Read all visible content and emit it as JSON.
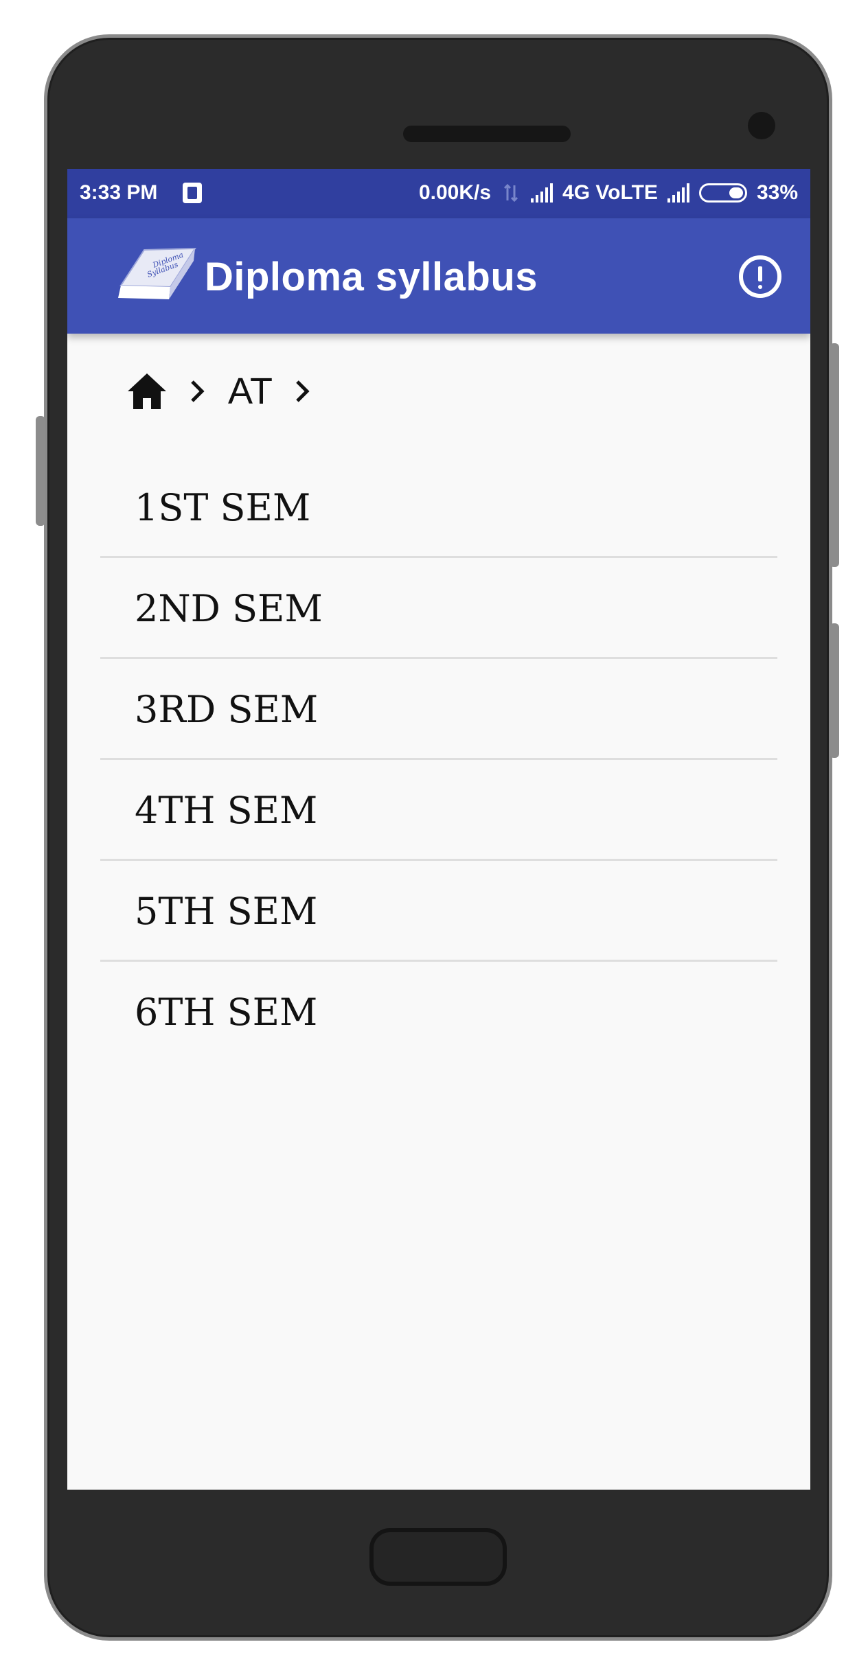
{
  "status_bar": {
    "time": "3:33 PM",
    "network_speed": "0.00K/s",
    "network_type": "4G VoLTE",
    "battery_percent": "33%"
  },
  "app_bar": {
    "title": "Diploma syllabus",
    "logo_text_line1": "Diploma",
    "logo_text_line2": "Syllabus"
  },
  "breadcrumb": {
    "home_icon": "home-icon",
    "items": [
      "AT"
    ]
  },
  "semesters": [
    {
      "label": "1ST SEM"
    },
    {
      "label": "2ND SEM"
    },
    {
      "label": "3RD SEM"
    },
    {
      "label": "4TH SEM"
    },
    {
      "label": "5TH SEM"
    },
    {
      "label": "6TH SEM"
    }
  ],
  "colors": {
    "status_bar": "#303f9f",
    "app_bar": "#3f51b5",
    "background": "#f9f9f9",
    "divider": "#dedede"
  }
}
